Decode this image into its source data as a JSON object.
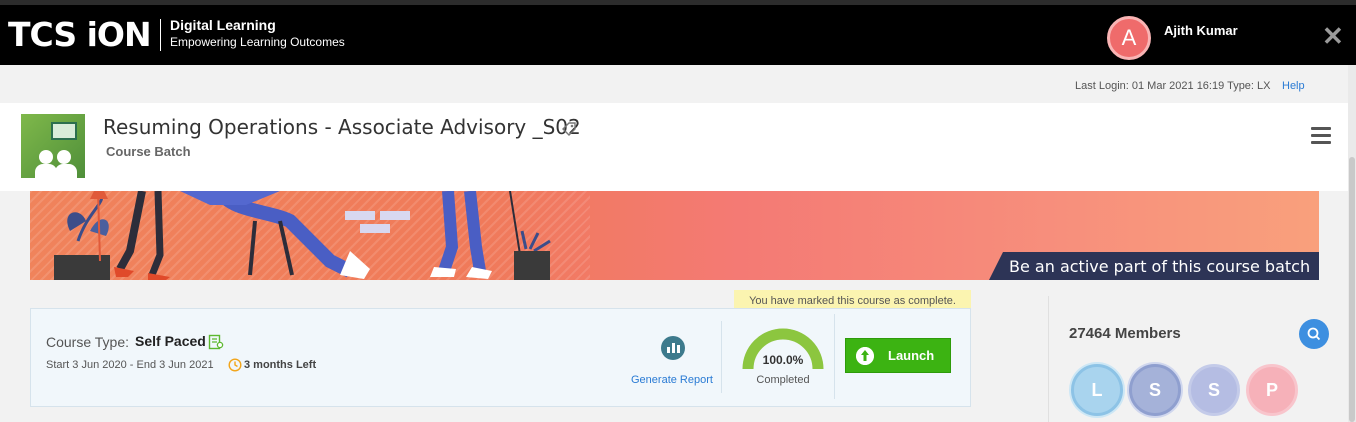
{
  "header": {
    "logo": "TCS iON",
    "brand_title": "Digital Learning",
    "brand_subtitle": "Empowering Learning Outcomes",
    "avatar_initial": "A",
    "user_name": "Ajith Kumar",
    "close_symbol": "✕"
  },
  "session": {
    "last_login": "Last Login: 01 Mar 2021 16:19 Type: LX",
    "help_label": "Help"
  },
  "course": {
    "title": "Resuming Operations - Associate Advisory _S02",
    "subtitle": "Course Batch",
    "banner_caption": "Be an active part of this course batch",
    "completion_note": "You have marked this course as complete.",
    "type_label": "Course Type:",
    "type_value": "Self Paced",
    "dates": "Start 3 Jun 2020 - End  3 Jun 2021",
    "time_left": "3 months Left",
    "report_label": "Generate Report",
    "progress_text": "100.0%",
    "progress_fraction": 1.0,
    "progress_label": "Completed",
    "launch_label": "Launch"
  },
  "members": {
    "count_label": "27464 Members",
    "avatars": [
      "L",
      "S",
      "S",
      "P"
    ]
  },
  "colors": {
    "header_bg": "#000000",
    "accent_blue": "#2a7bd4",
    "launch_green": "#3cb312",
    "gauge_green": "#8cc63f",
    "avatar_red": "#ef6b6b"
  },
  "icons": [
    "tag-icon",
    "menu-icon",
    "certificate-icon",
    "clock-icon",
    "report-icon",
    "search-icon",
    "launch-icon",
    "close-icon"
  ]
}
